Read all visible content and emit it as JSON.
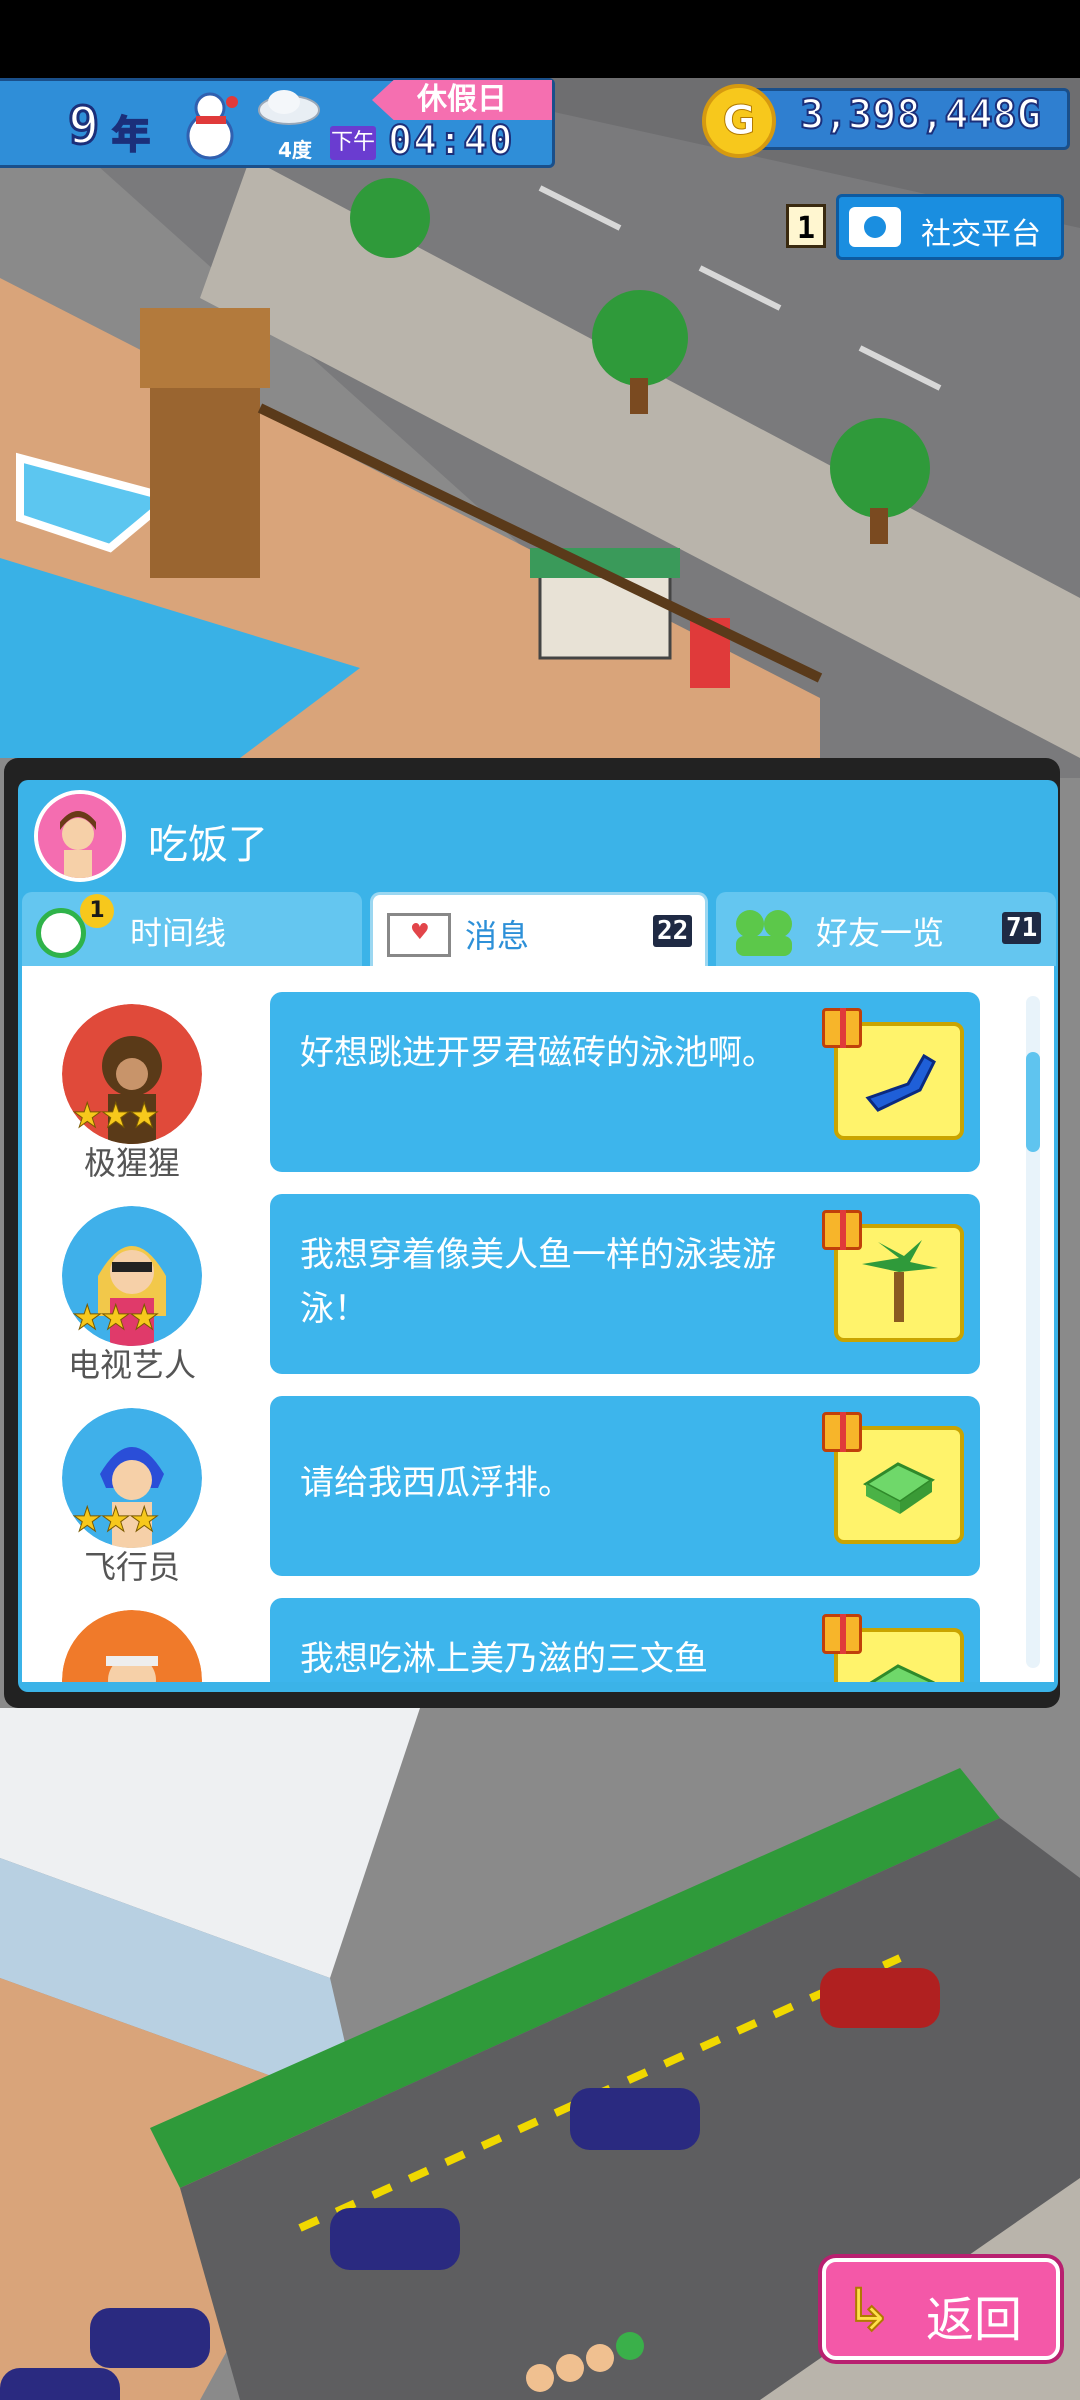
{
  "hud": {
    "year_number": "9",
    "year_unit": "年",
    "weather_temp": "4度",
    "ampm": "下午",
    "clock": "04:40",
    "holiday": "休假日",
    "gold_symbol": "G",
    "gold_amount": "3,398,448G"
  },
  "social": {
    "count": "1",
    "label": "社交平台"
  },
  "panel": {
    "title": "吃饭了",
    "tabs": [
      {
        "label": "时间线",
        "badge": "1",
        "count": ""
      },
      {
        "label": "消息",
        "count": "22"
      },
      {
        "label": "好友一览",
        "count": "71"
      }
    ],
    "messages": [
      {
        "name": "极猩猩",
        "stars": "★★★",
        "text": "好想跳进开罗君磁砖的泳池啊。",
        "gift_icon": "pool-chair-icon"
      },
      {
        "name": "电视艺人",
        "stars": "★★★",
        "text": "我想穿着像美人鱼一样的泳装游泳！",
        "gift_icon": "palm-tree-icon"
      },
      {
        "name": "飞行员",
        "stars": "★★★",
        "text": "请给我西瓜浮排。",
        "gift_icon": "green-float-icon"
      },
      {
        "name": "",
        "stars": "",
        "text": "我想吃淋上美乃滋的三文鱼",
        "gift_icon": "green-float-icon"
      }
    ]
  },
  "back_button": {
    "label": "返回"
  },
  "colors": {
    "panel_blue": "#3bb3e8",
    "bubble_blue": "#3db5ec",
    "back_pink": "#f458a8",
    "gold": "#f7c81c"
  }
}
